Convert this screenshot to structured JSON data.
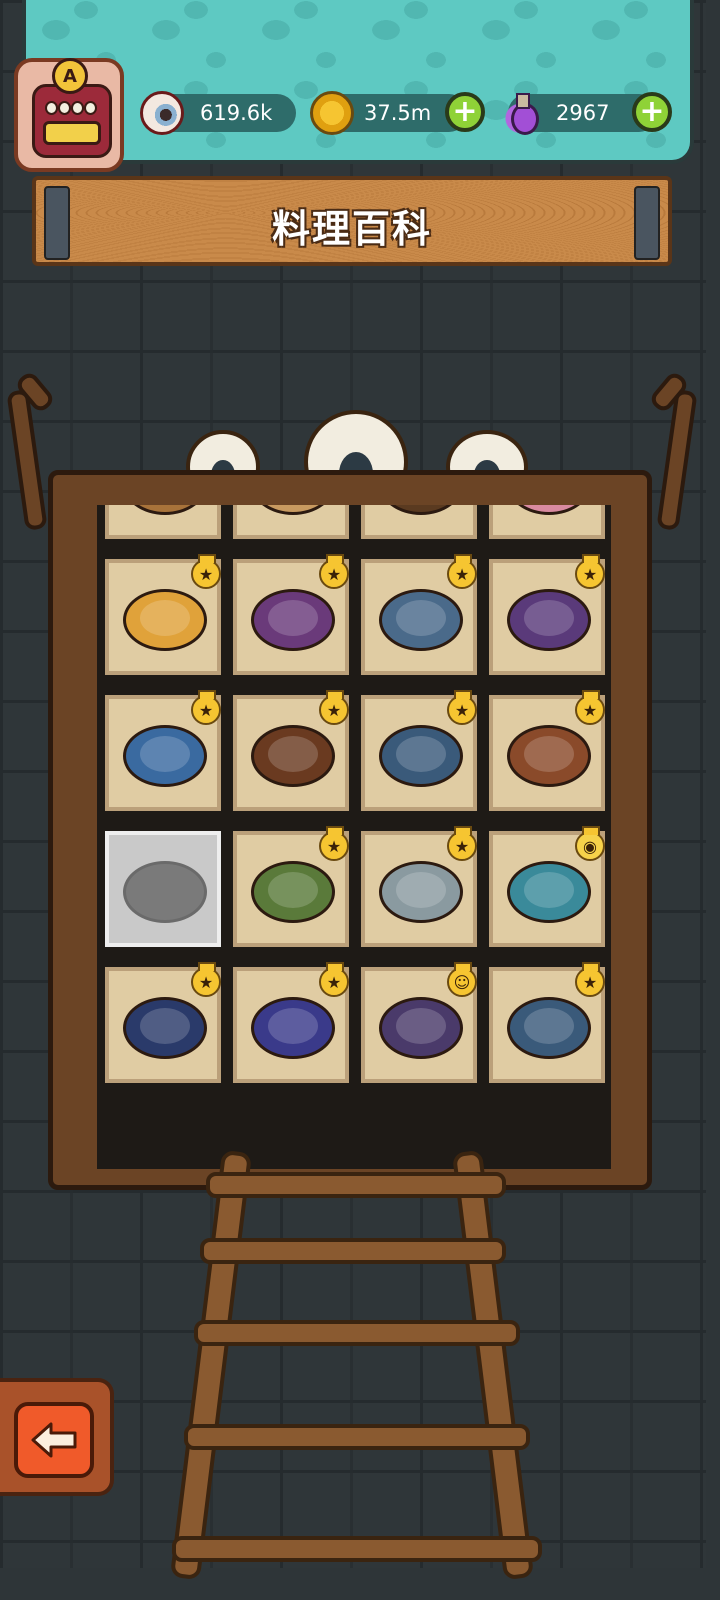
{
  "header": {
    "player_badge_letter": "A",
    "eyeball": {
      "value": "619.6k",
      "icon": "eyeball-icon"
    },
    "coins": {
      "value": "37.5m",
      "icon": "coin-icon"
    },
    "potion": {
      "value": "2967",
      "icon": "potion-icon"
    },
    "plus_symbol": "+"
  },
  "title": "料理百科",
  "colors": {
    "teal": "#5ec9c2",
    "wood": "#6b4425",
    "plus": "#8fd237",
    "back": "#f05a2a"
  },
  "dishes": [
    {
      "color": "#a8733a",
      "status": "none",
      "partial": true
    },
    {
      "color": "#c89a60",
      "status": "none",
      "partial": true
    },
    {
      "color": "#5a3a20",
      "status": "none",
      "partial": true
    },
    {
      "color": "#d98aa0",
      "status": "none",
      "partial": true
    },
    {
      "color": "#e0a23a",
      "status": "unlocked"
    },
    {
      "color": "#6a3a7a",
      "status": "unlocked"
    },
    {
      "color": "#4a6a8a",
      "status": "unlocked"
    },
    {
      "color": "#5a3a7a",
      "status": "unlocked"
    },
    {
      "color": "#3a6aa0",
      "status": "unlocked"
    },
    {
      "color": "#6a3a20",
      "status": "unlocked"
    },
    {
      "color": "#3a5a7a",
      "status": "unlocked"
    },
    {
      "color": "#8a4a2a",
      "status": "unlocked"
    },
    {
      "color": "#7a7a7a",
      "status": "locked"
    },
    {
      "color": "#5a7a3a",
      "status": "unlocked"
    },
    {
      "color": "#8a9aa0",
      "status": "unlocked"
    },
    {
      "color": "#3a8a9a",
      "status": "favorite"
    },
    {
      "color": "#2a3a6a",
      "status": "unlocked"
    },
    {
      "color": "#3a3a8a",
      "status": "unlocked"
    },
    {
      "color": "#4a3a6a",
      "status": "happy"
    },
    {
      "color": "#3a5a7a",
      "status": "unlocked"
    }
  ]
}
